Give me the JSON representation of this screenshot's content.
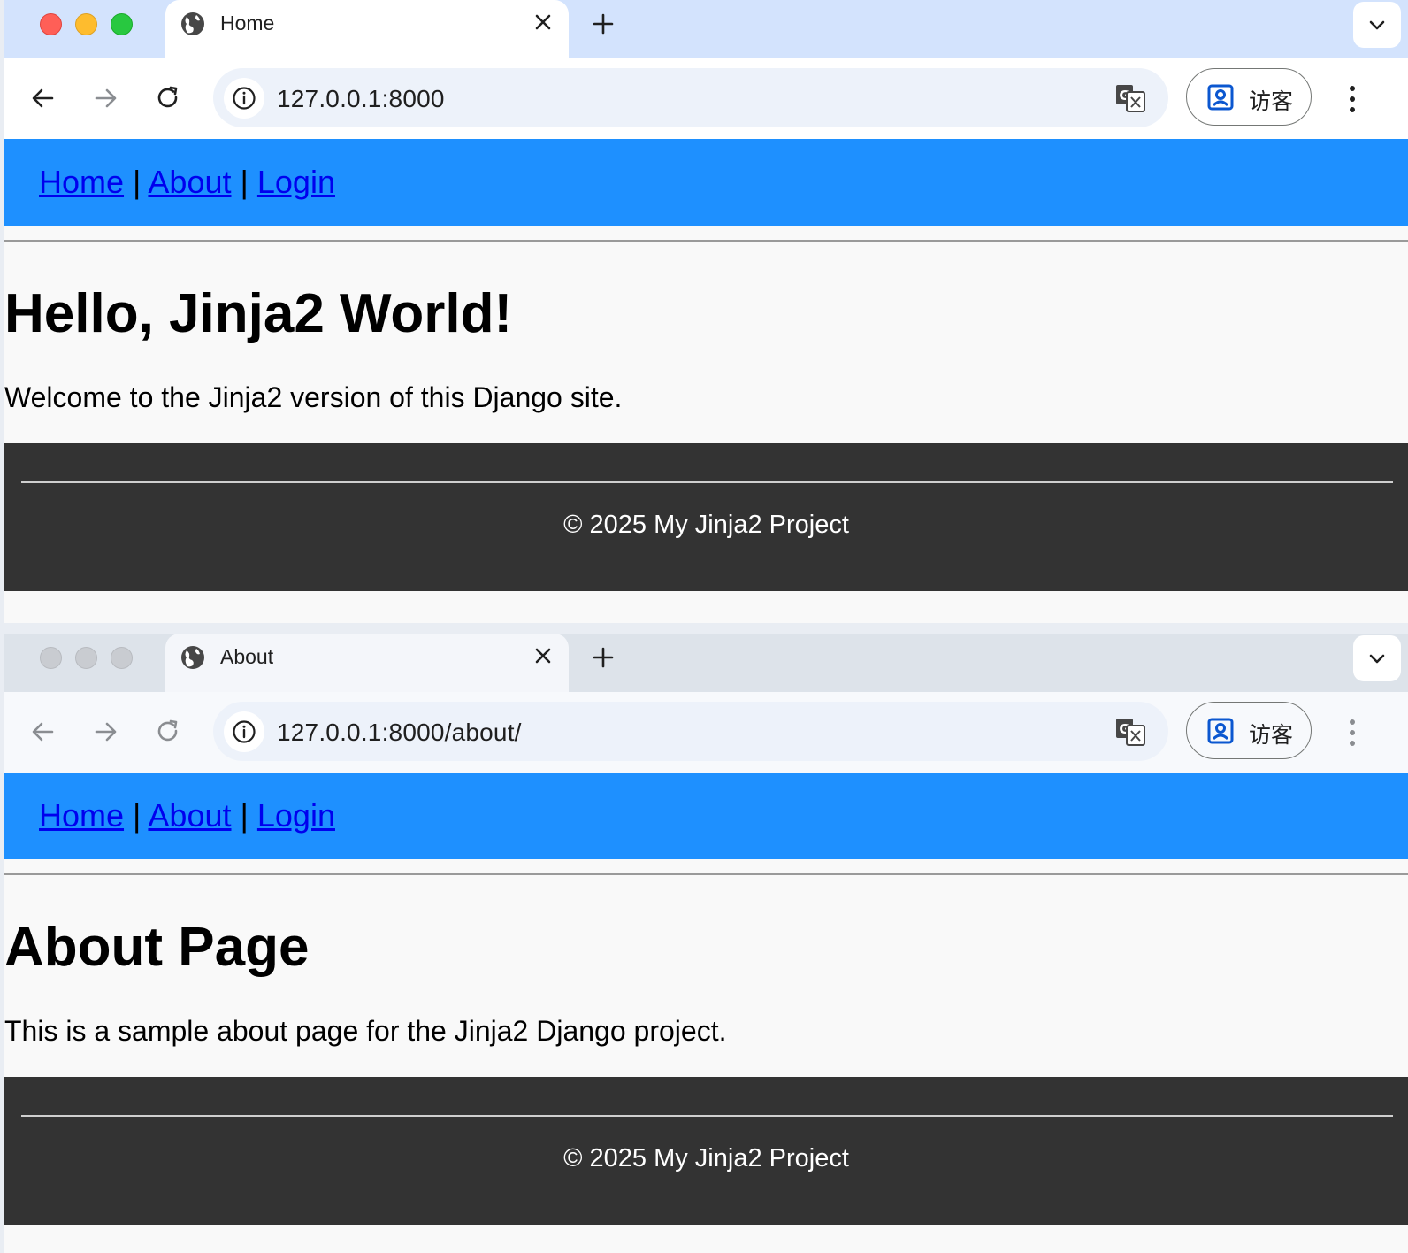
{
  "windows": [
    {
      "tab_title": "Home",
      "url": "127.0.0.1:8000",
      "profile_label": "访客",
      "nav": {
        "home": "Home",
        "about": "About",
        "login": "Login",
        "separator": "|"
      },
      "heading": "Hello, Jinja2 World!",
      "paragraph": "Welcome to the Jinja2 version of this Django site.",
      "footer": "© 2025 My Jinja2 Project"
    },
    {
      "tab_title": "About",
      "url": "127.0.0.1:8000/about/",
      "profile_label": "访客",
      "nav": {
        "home": "Home",
        "about": "About",
        "login": "Login",
        "separator": "|"
      },
      "heading": "About Page",
      "paragraph": "This is a sample about page for the Jinja2 Django project.",
      "footer": "© 2025 My Jinja2 Project"
    }
  ],
  "colors": {
    "nav_strip": "#1e90ff",
    "link": "#0000ee",
    "footer_bg": "#333333",
    "tabbar_active": "#d3e3fd",
    "tabbar_inactive": "#dde3ea"
  },
  "icons": {
    "tab": "globe-icon",
    "close": "close-icon",
    "new_tab": "plus-icon",
    "back": "back-arrow-icon",
    "forward": "forward-arrow-icon",
    "reload": "reload-icon",
    "site_info": "info-icon",
    "translate": "translate-icon",
    "profile": "profile-icon",
    "menu": "kebab-menu-icon"
  }
}
